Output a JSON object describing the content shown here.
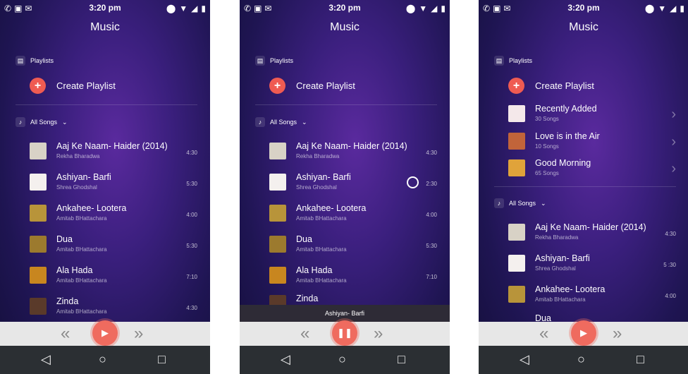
{
  "status": {
    "time": "3:20 pm"
  },
  "app_title": "Music",
  "playlists_label": "Playlists",
  "create_playlist_label": "Create Playlist",
  "all_songs_label": "All Songs",
  "songs": [
    {
      "title": "Aaj Ke Naam- Haider (2014)",
      "artist": "Rekha Bharadwa",
      "duration": "4:30",
      "art_color": "#d8d2c6"
    },
    {
      "title": "Ashiyan- Barfi",
      "artist": "Shrea Ghodshal",
      "duration": "5:30",
      "art_color": "#f4f0ee"
    },
    {
      "title": "Ankahee- Lootera",
      "artist": "Amitab BHattachara",
      "duration": "4:00",
      "art_color": "#b8943a"
    },
    {
      "title": "Dua",
      "artist": "Amitab BHattachara",
      "duration": "5:30",
      "art_color": "#9c7a2e"
    },
    {
      "title": "Ala Hada",
      "artist": "Amitab BHattachara",
      "duration": "7:10",
      "art_color": "#c8861f"
    },
    {
      "title": "Zinda",
      "artist": "Amitab BHattachara",
      "duration": "4:30",
      "art_color": "#5a3a2a"
    }
  ],
  "screen2_song2_duration": "2:30",
  "now_playing": "Ashiyan- Barfi",
  "screen3_song2_duration": "5 :30",
  "playlist_items": [
    {
      "title": "Recently Added",
      "count": "30 Songs",
      "art_color": "#f4e8ea"
    },
    {
      "title": "Love is in the Air",
      "count": "10 Songs",
      "art_color": "#c1643a"
    },
    {
      "title": "Good Morning",
      "count": "65 Songs",
      "art_color": "#e0a33a"
    }
  ],
  "colors": {
    "accent": "#ef5b52",
    "player_bar": "#e7e7e7",
    "nav_bar": "#2b2f33"
  }
}
